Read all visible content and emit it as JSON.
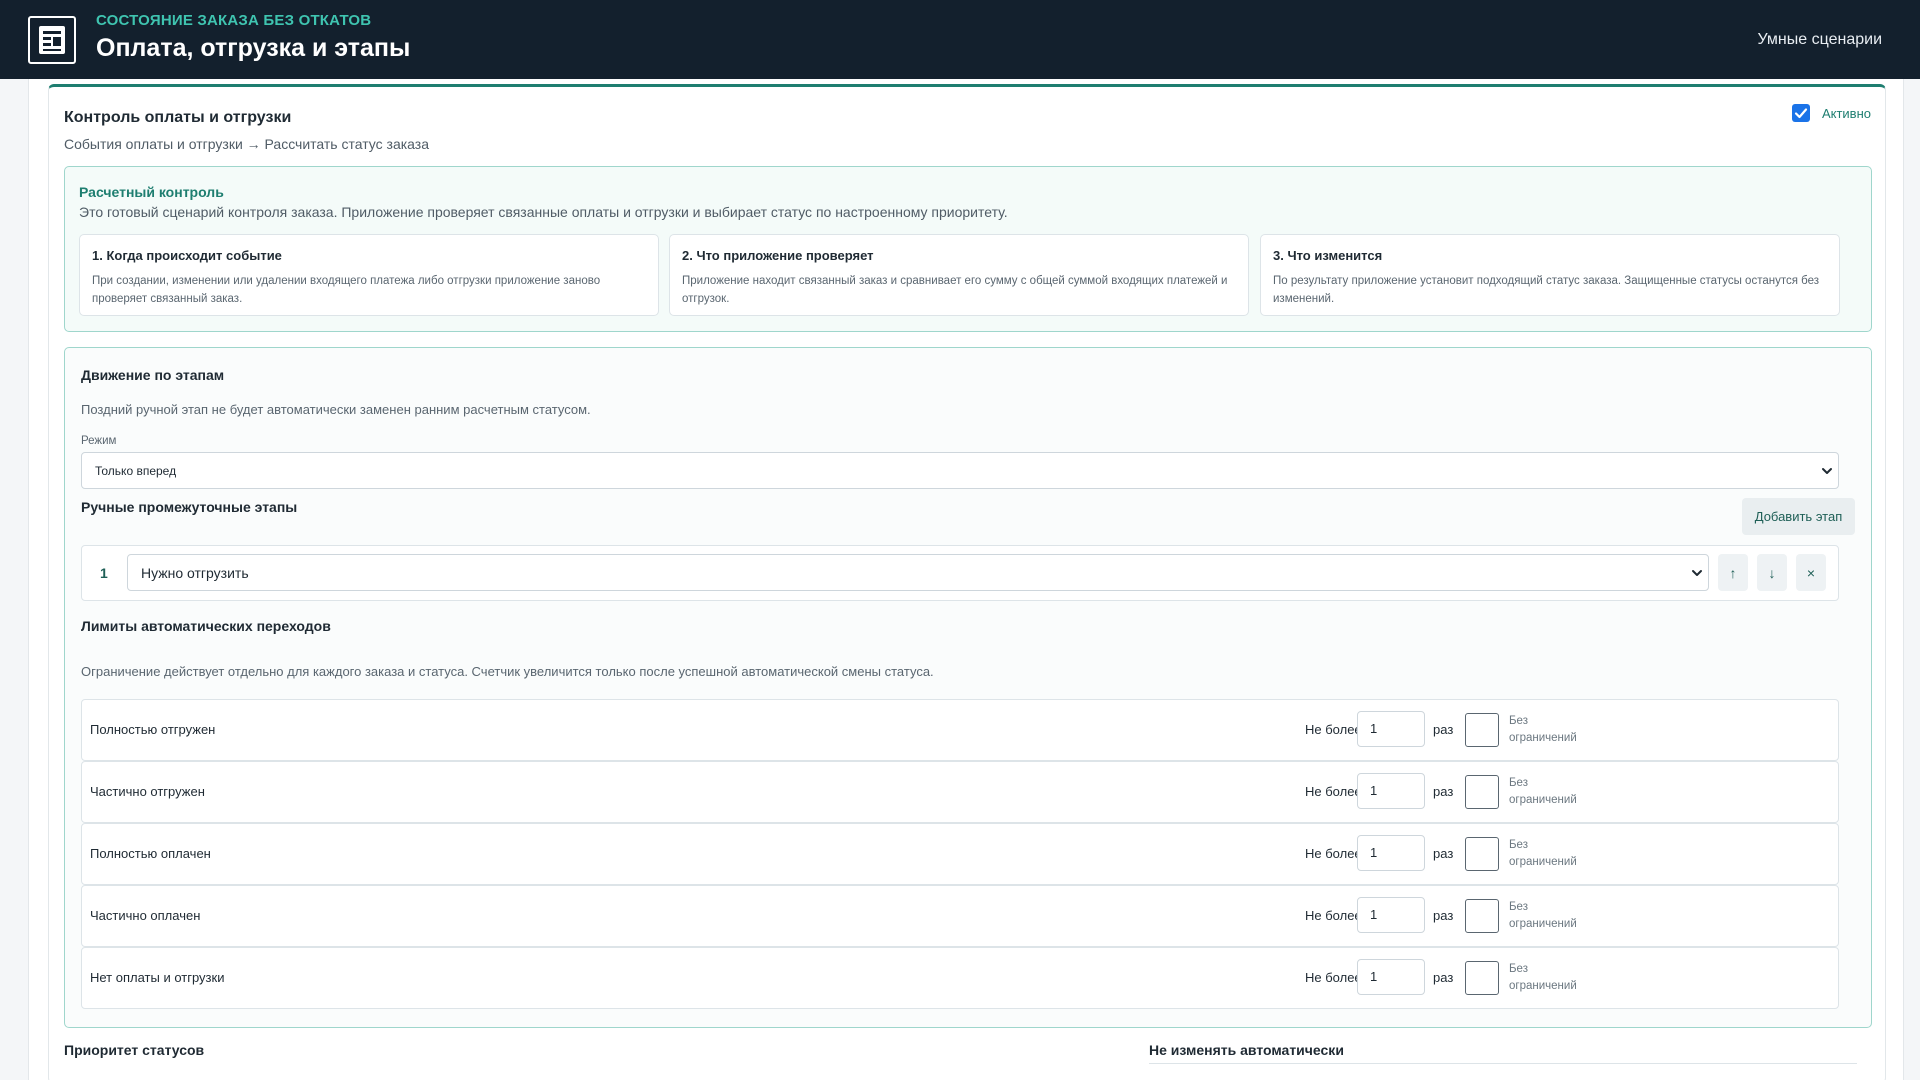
{
  "header": {
    "subtitle": "СОСТОЯНИЕ ЗАКАЗА БЕЗ ОТКАТОВ",
    "title": "Оплата, отгрузка и этапы",
    "smart_link": "Умные сценарии",
    "logo_icon": "document-stack-icon"
  },
  "card": {
    "title": "Контроль оплаты и отгрузки",
    "subtitle": "События оплаты и отгрузки → Рассчитать статус заказа",
    "active_label": "Активно",
    "active_checked": true
  },
  "calc": {
    "title": "Расчетный контроль",
    "description": "Это готовый сценарий контроля заказа. Приложение проверяет связанные оплаты и отгрузки и выбирает статус по настроенному приоритету.",
    "steps": [
      {
        "title": "1. Когда происходит событие",
        "text": "При создании, изменении или удалении входящего платежа либо отгрузки приложение заново проверяет связанный заказ."
      },
      {
        "title": "2. Что приложение проверяет",
        "text": "Приложение находит связанный заказ и сравнивает его сумму с общей суммой входящих платежей и отгрузок."
      },
      {
        "title": "3. Что изменится",
        "text": "По результату приложение установит подходящий статус заказа. Защищенные статусы останутся без изменений."
      }
    ]
  },
  "moves": {
    "title": "Движение по этапам",
    "description": "Поздний ручной этап не будет автоматически заменен ранним расчетным статусом.",
    "mode_label": "Режим",
    "mode_value": "Только вперед",
    "manual_title": "Ручные промежуточные этапы",
    "add_button": "Добавить этап",
    "stages": [
      {
        "number": "1",
        "value": "Нужно отгрузить"
      }
    ],
    "stage_buttons": {
      "up": "↑",
      "down": "↓",
      "remove": "×"
    }
  },
  "limits": {
    "title": "Лимиты автоматических переходов",
    "description": "Ограничение действует отдельно для каждого заказа и статуса. Счетчик увеличится только после успешной автоматической смены статуса.",
    "not_more": "Не более",
    "times": "раз",
    "no_limit": "Без ограничений",
    "rows": [
      {
        "name": "Полностью отгружен",
        "value": "1"
      },
      {
        "name": "Частично отгружен",
        "value": "1"
      },
      {
        "name": "Полностью оплачен",
        "value": "1"
      },
      {
        "name": "Частично оплачен",
        "value": "1"
      },
      {
        "name": "Нет оплаты и отгрузки",
        "value": "1"
      }
    ]
  },
  "bottom": {
    "priority_title": "Приоритет статусов",
    "no_auto_title": "Не изменять автоматически"
  },
  "colors": {
    "topbar": "#13202d",
    "accent": "#3fc4b0",
    "brand": "#1e7e70",
    "checkbox": "#1a73e8"
  }
}
